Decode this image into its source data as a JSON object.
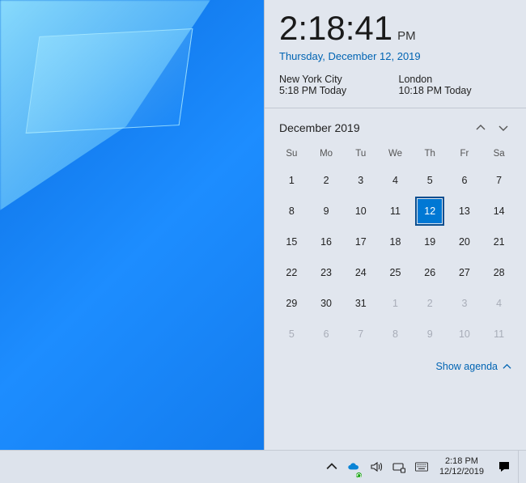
{
  "clock": {
    "time": "2:18:41",
    "ampm": "PM",
    "full_date": "Thursday, December 12, 2019"
  },
  "world_clocks": [
    {
      "city": "New York City",
      "time": "5:18 PM Today"
    },
    {
      "city": "London",
      "time": "10:18 PM Today"
    }
  ],
  "calendar": {
    "title": "December 2019",
    "dow": [
      "Su",
      "Mo",
      "Tu",
      "We",
      "Th",
      "Fr",
      "Sa"
    ],
    "today": 12,
    "weeks": [
      [
        {
          "n": 1
        },
        {
          "n": 2
        },
        {
          "n": 3
        },
        {
          "n": 4
        },
        {
          "n": 5
        },
        {
          "n": 6
        },
        {
          "n": 7
        }
      ],
      [
        {
          "n": 8
        },
        {
          "n": 9
        },
        {
          "n": 10
        },
        {
          "n": 11
        },
        {
          "n": 12,
          "today": true
        },
        {
          "n": 13
        },
        {
          "n": 14
        }
      ],
      [
        {
          "n": 15
        },
        {
          "n": 16
        },
        {
          "n": 17
        },
        {
          "n": 18
        },
        {
          "n": 19
        },
        {
          "n": 20
        },
        {
          "n": 21
        }
      ],
      [
        {
          "n": 22
        },
        {
          "n": 23
        },
        {
          "n": 24
        },
        {
          "n": 25
        },
        {
          "n": 26
        },
        {
          "n": 27
        },
        {
          "n": 28
        }
      ],
      [
        {
          "n": 29
        },
        {
          "n": 30
        },
        {
          "n": 31
        },
        {
          "n": 1,
          "other": true
        },
        {
          "n": 2,
          "other": true
        },
        {
          "n": 3,
          "other": true
        },
        {
          "n": 4,
          "other": true
        }
      ],
      [
        {
          "n": 5,
          "other": true
        },
        {
          "n": 6,
          "other": true
        },
        {
          "n": 7,
          "other": true
        },
        {
          "n": 8,
          "other": true
        },
        {
          "n": 9,
          "other": true
        },
        {
          "n": 10,
          "other": true
        },
        {
          "n": 11,
          "other": true
        }
      ]
    ]
  },
  "agenda_label": "Show agenda",
  "taskbar": {
    "clock_time": "2:18 PM",
    "clock_date": "12/12/2019"
  }
}
